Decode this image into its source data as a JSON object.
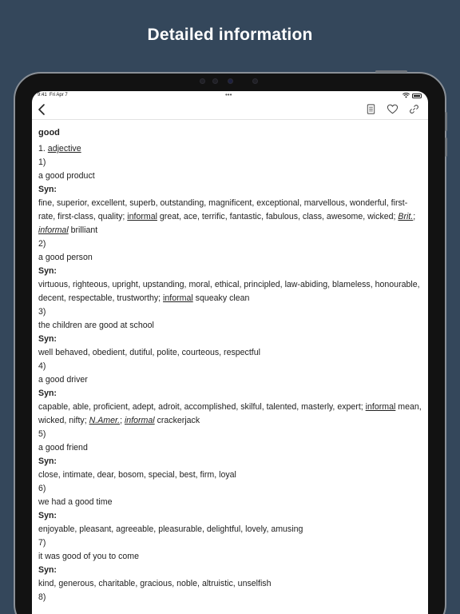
{
  "headline": "Detailed information",
  "status": {
    "time": "9:41",
    "date": "Fri Apr 7",
    "dots": "•••"
  },
  "nav": {
    "back_icon": "chevron-left-icon",
    "icons": [
      "document-icon",
      "heart-icon",
      "link-icon"
    ]
  },
  "entry": {
    "word": "good",
    "pos_number": "1.",
    "pos": "adjective",
    "syn_label": "Syn:",
    "senses": [
      {
        "num": "1)",
        "example": "a good product",
        "syn_a": "fine, superior, excellent, superb, outstanding, magnificent, exceptional, marvellous, wonderful, first-rate, first-class, quality; ",
        "tag1": "informal",
        "syn_b": " great, ace, terrific, fantastic, fabulous, class, awesome, wicked; ",
        "tag2": "Brit.",
        "sep": "; ",
        "tag3": "informal",
        "syn_c": " brilliant"
      },
      {
        "num": "2)",
        "example": "a good person",
        "syn_a": "virtuous, righteous, upright, upstanding, moral, ethical, principled, law-abiding, blameless, honourable, decent, respectable, trustworthy; ",
        "tag1": "informal",
        "syn_b": " squeaky clean"
      },
      {
        "num": "3)",
        "example": "the children are good at school",
        "syn": "well behaved, obedient, dutiful, polite, courteous, respectful"
      },
      {
        "num": "4)",
        "example": "a good driver",
        "syn_a": "capable, able, proficient, adept, adroit, accomplished, skilful, talented, masterly, expert; ",
        "tag1": "informal",
        "syn_b": " mean, wicked, nifty; ",
        "tag2": "N.Amer.",
        "sep": "; ",
        "tag3": "informal",
        "syn_c": " crackerjack"
      },
      {
        "num": "5)",
        "example": "a good friend",
        "syn": "close, intimate, dear, bosom, special, best, firm, loyal"
      },
      {
        "num": "6)",
        "example": "we had a good time",
        "syn": "enjoyable, pleasant, agreeable, pleasurable, delightful, lovely, amusing"
      },
      {
        "num": "7)",
        "example": "it was good of you to come",
        "syn": "kind, generous, charitable, gracious, noble, altruistic, unselfish"
      },
      {
        "num": "8)"
      }
    ]
  }
}
